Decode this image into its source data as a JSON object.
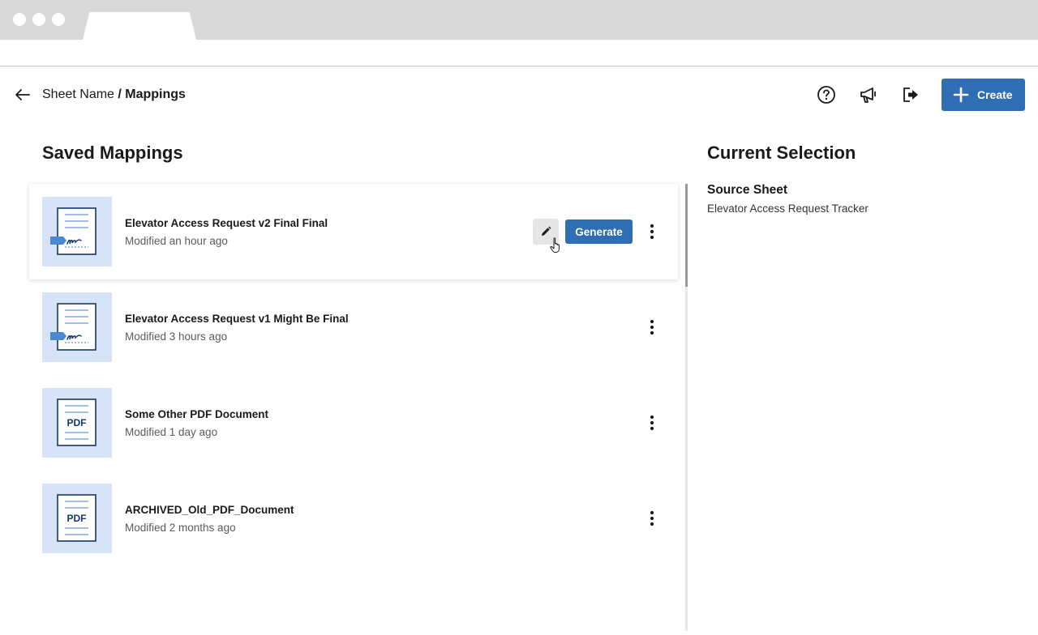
{
  "header": {
    "breadcrumb_parent": "Sheet Name",
    "breadcrumb_separator": " / ",
    "breadcrumb_current": "Mappings",
    "create_label": "Create"
  },
  "icons": {
    "back": "arrow-left-icon",
    "help": "question-circle-icon",
    "announcements": "megaphone-icon",
    "logout": "sign-out-icon",
    "create": "plus-icon",
    "edit": "pencil-icon",
    "more": "vertical-ellipsis-icon",
    "doc_signature": "signature-document-icon",
    "doc_pdf": "pdf-document-icon"
  },
  "colors": {
    "accent": "#2f6db5",
    "thumbnail_bg": "#d7e4f8",
    "icon_dark": "#16366b",
    "icon_mid": "#4a88d0"
  },
  "saved_mappings": {
    "title": "Saved Mappings",
    "generate_label": "Generate",
    "items": [
      {
        "name": "Elevator Access Request v2 Final Final",
        "modified": "Modified an hour ago",
        "thumbnail": "signature",
        "selected": true
      },
      {
        "name": "Elevator Access Request v1 Might Be Final",
        "modified": "Modified 3 hours ago",
        "thumbnail": "signature",
        "selected": false
      },
      {
        "name": "Some Other PDF Document",
        "modified": "Modified 1 day ago",
        "thumbnail": "pdf",
        "pdf_label": "PDF",
        "selected": false
      },
      {
        "name": "ARCHIVED_Old_PDF_Document",
        "modified": "Modified 2 months ago",
        "thumbnail": "pdf",
        "pdf_label": "PDF",
        "selected": false
      }
    ]
  },
  "current_selection": {
    "title": "Current Selection",
    "source_sheet_label": "Source Sheet",
    "source_sheet_value": "Elevator Access Request Tracker"
  }
}
